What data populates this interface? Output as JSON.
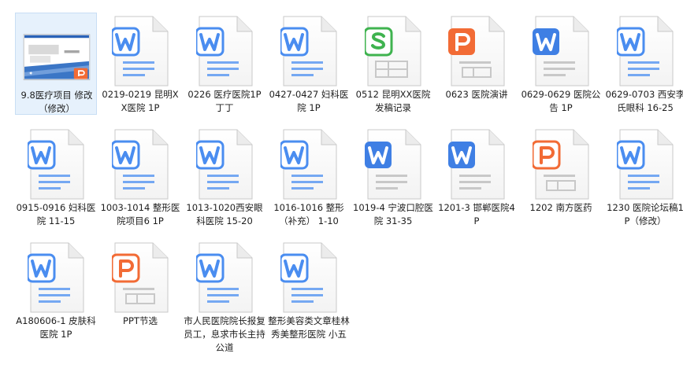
{
  "colors": {
    "word_blue": "#4a8df0",
    "word_blue_dark": "#3f7fe4",
    "ppt_orange": "#f26b35",
    "sheet_green": "#3fb34f",
    "page_border": "#c9c9c9",
    "select_bg": "#e6f1fc"
  },
  "files": [
    {
      "label": "9.8医疗项目 修改（修改）",
      "icon": "ppt-thumbnail-icon",
      "type": "ppt-thumb",
      "selected": true
    },
    {
      "label": "0219-0219 昆明XX医院 1P",
      "icon": "word-doc-icon",
      "type": "word"
    },
    {
      "label": "0226 医疗医院1P 丁丁",
      "icon": "word-doc-icon",
      "type": "word"
    },
    {
      "label": "0427-0427 妇科医院 1P",
      "icon": "word-doc-icon",
      "type": "word"
    },
    {
      "label": "0512 昆明XX医院 发稿记录",
      "icon": "spreadsheet-icon",
      "type": "sheet"
    },
    {
      "label": "0623 医院演讲",
      "icon": "presentation-icon",
      "type": "ppt-filled"
    },
    {
      "label": "0629-0629 医院公告 1P",
      "icon": "word-doc-icon",
      "type": "word-filled"
    },
    {
      "label": "0629-0703 西安李氏眼科 16-25",
      "icon": "word-doc-icon",
      "type": "word"
    },
    {
      "label": "0915-0916 妇科医院 11-15",
      "icon": "word-doc-icon",
      "type": "word"
    },
    {
      "label": "1003-1014 整形医院项目6 1P",
      "icon": "word-doc-icon",
      "type": "word"
    },
    {
      "label": "1013-1020西安眼科医院 15-20",
      "icon": "word-doc-icon",
      "type": "word"
    },
    {
      "label": "1016-1016 整形（补充） 1-10",
      "icon": "word-doc-icon",
      "type": "word"
    },
    {
      "label": "1019-4 宁波口腔医院 31-35",
      "icon": "word-doc-icon",
      "type": "word-filled"
    },
    {
      "label": "1201-3 邯郸医院4P",
      "icon": "word-doc-icon",
      "type": "word-filled"
    },
    {
      "label": "1202 南方医药",
      "icon": "presentation-icon",
      "type": "ppt"
    },
    {
      "label": "1230 医院论坛稿1P（修改）",
      "icon": "word-doc-icon",
      "type": "word"
    },
    {
      "label": "A180606-1 皮肤科医院 1P",
      "icon": "word-doc-icon",
      "type": "word"
    },
    {
      "label": "PPT节选",
      "icon": "presentation-icon",
      "type": "ppt"
    },
    {
      "label": "市人民医院院长报复员工，息求市长主持公道",
      "icon": "word-doc-icon",
      "type": "word"
    },
    {
      "label": "整形美容类文章桂林秀美整形医院 小五",
      "icon": "word-doc-icon",
      "type": "word"
    }
  ]
}
